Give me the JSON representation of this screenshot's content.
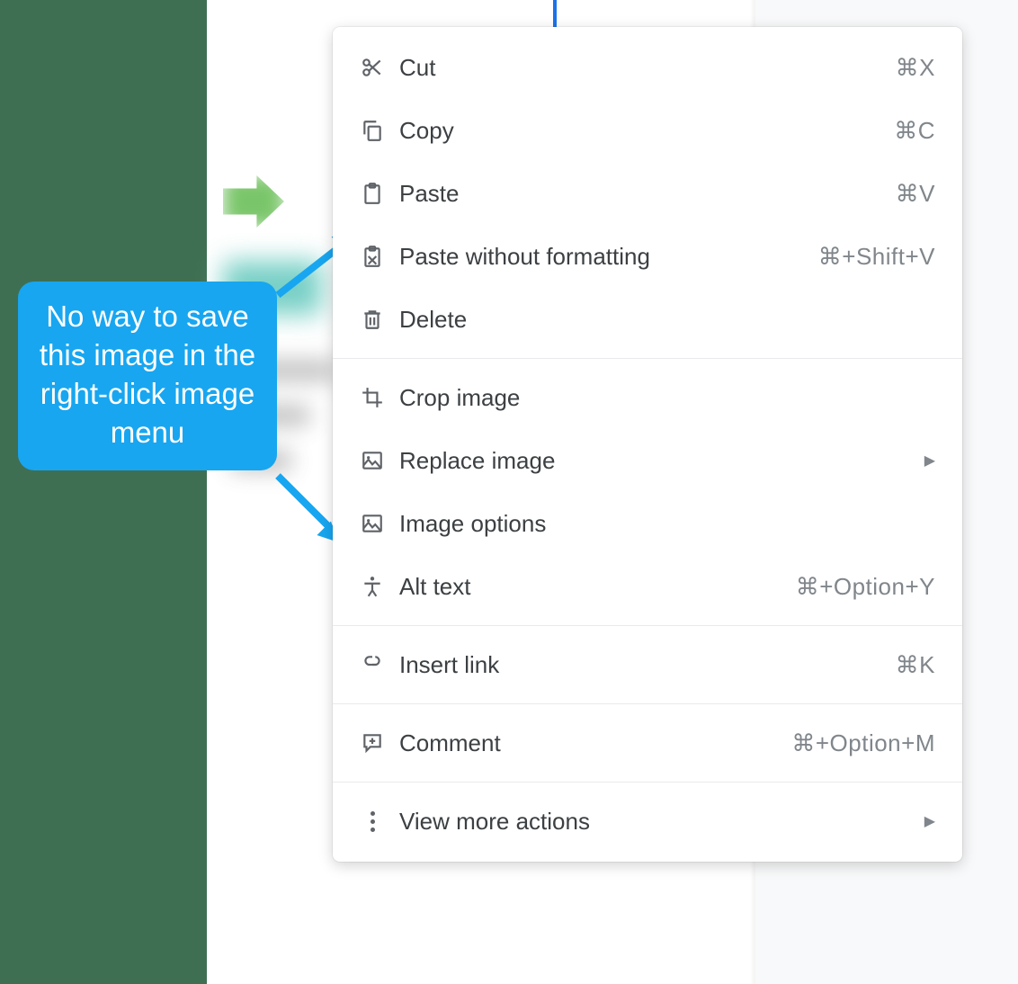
{
  "callout": {
    "text": "No way to save this image in the right-click image menu"
  },
  "menu": {
    "groups": [
      [
        {
          "id": "cut",
          "label": "Cut",
          "shortcut": "⌘X"
        },
        {
          "id": "copy",
          "label": "Copy",
          "shortcut": "⌘C"
        },
        {
          "id": "paste",
          "label": "Paste",
          "shortcut": "⌘V"
        },
        {
          "id": "paste-no-fmt",
          "label": "Paste without formatting",
          "shortcut": "⌘+Shift+V"
        },
        {
          "id": "delete",
          "label": "Delete",
          "shortcut": ""
        }
      ],
      [
        {
          "id": "crop",
          "label": "Crop image",
          "shortcut": ""
        },
        {
          "id": "replace",
          "label": "Replace image",
          "shortcut": "",
          "submenu": true
        },
        {
          "id": "image-options",
          "label": "Image options",
          "shortcut": ""
        },
        {
          "id": "alt-text",
          "label": "Alt text",
          "shortcut": "⌘+Option+Y"
        }
      ],
      [
        {
          "id": "insert-link",
          "label": "Insert link",
          "shortcut": "⌘K"
        }
      ],
      [
        {
          "id": "comment",
          "label": "Comment",
          "shortcut": "⌘+Option+M"
        }
      ],
      [
        {
          "id": "more",
          "label": "View more actions",
          "shortcut": "",
          "submenu": true
        }
      ]
    ]
  }
}
